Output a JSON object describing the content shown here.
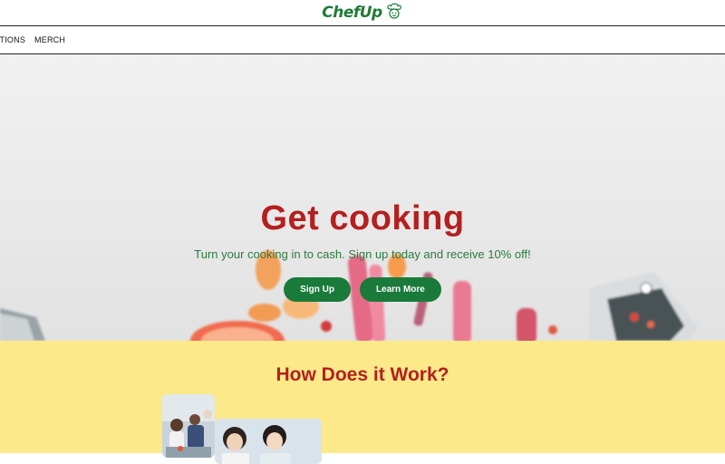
{
  "brand": {
    "logo_text": "ChefUp"
  },
  "nav": {
    "items": [
      "ATIONS",
      "MERCH"
    ]
  },
  "hero": {
    "title": "Get cooking",
    "subtitle": "Turn your cooking in to cash. Sign up today and receive 10% off!",
    "primary_button": "Sign Up",
    "secondary_button": "Learn More"
  },
  "how": {
    "title": "How Does it Work?"
  },
  "colors": {
    "brand_green": "#1a7a3a",
    "title_red": "#b3201f",
    "section_yellow": "#fbe98a"
  }
}
